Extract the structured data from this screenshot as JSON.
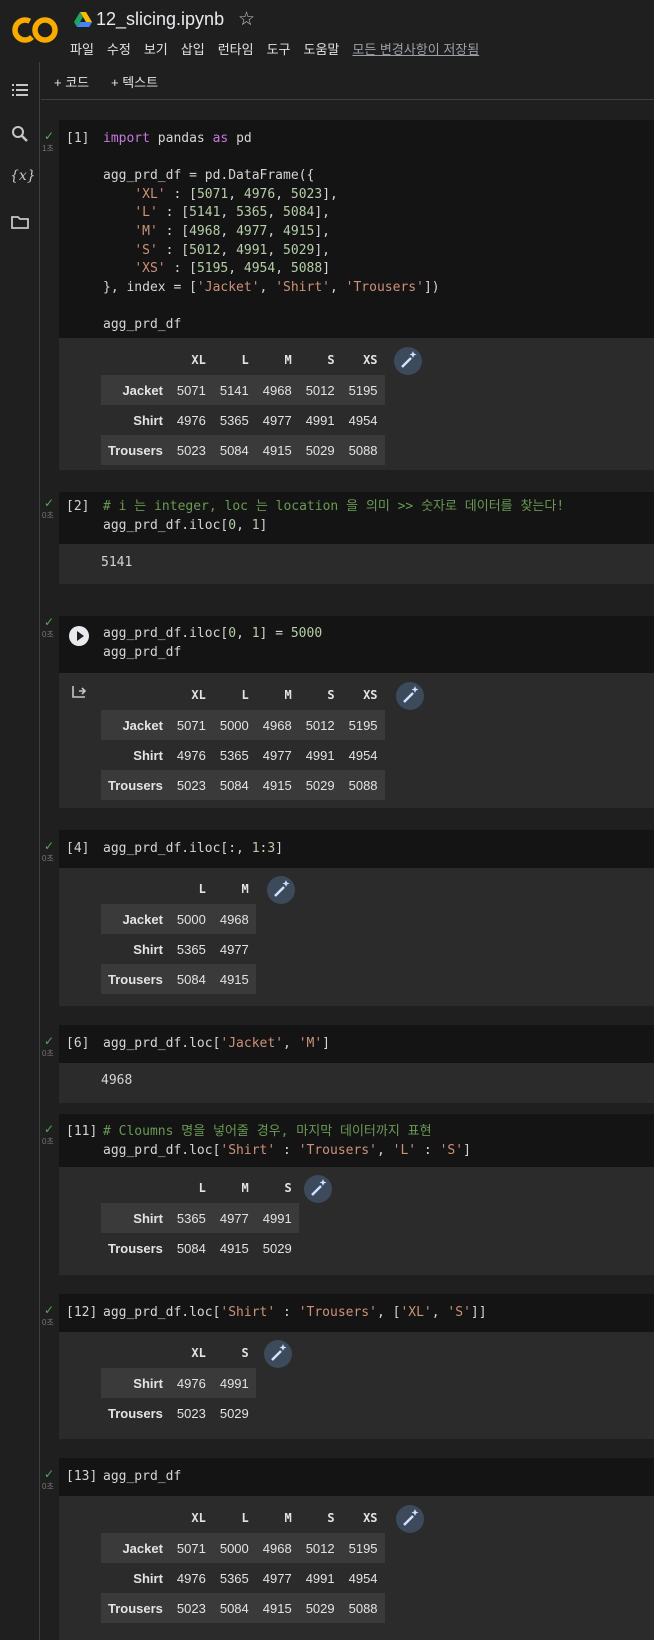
{
  "app": {
    "filename": "12_slicing.ipynb",
    "menu": [
      "파일",
      "수정",
      "보기",
      "삽입",
      "런타임",
      "도구",
      "도움말"
    ],
    "save_status": "모든 변경사항이 저장됨",
    "toolbar": {
      "add_code": "+ 코드",
      "add_text": "+ 텍스트"
    },
    "rail_icons": [
      "table-of-contents-icon",
      "search-icon",
      "variables-icon",
      "files-icon"
    ]
  },
  "cells": [
    {
      "exec": "[1]",
      "time": "1초"
    },
    {
      "exec": "[2]",
      "time": "0초",
      "output": "5141"
    },
    {
      "exec": "",
      "time": "0초"
    },
    {
      "exec": "[4]",
      "time": "0초"
    },
    {
      "exec": "[6]",
      "time": "0초",
      "output": "4968"
    },
    {
      "exec": "[11]",
      "time": "0초"
    },
    {
      "exec": "[12]",
      "time": "0초"
    },
    {
      "exec": "[13]",
      "time": "0초"
    }
  ],
  "code": {
    "c1": [
      "import pandas as pd",
      "",
      "agg_prd_df = pd.DataFrame({",
      "    'XL' : [5071, 4976, 5023],",
      "    'L' : [5141, 5365, 5084],",
      "    'M' : [4968, 4977, 4915],",
      "    'S' : [5012, 4991, 5029],",
      "    'XS' : [5195, 4954, 5088]",
      "}, index = ['Jacket', 'Shirt', 'Trousers'])",
      "",
      "agg_prd_df"
    ],
    "c2": [
      "# i 는 integer, loc 는 location 을 의미 >> 숫자로 데이터를 찾는다!",
      "agg_prd_df.iloc[0, 1]"
    ],
    "c3": [
      "agg_prd_df.iloc[0, 1] = 5000",
      "agg_prd_df"
    ],
    "c4": [
      "agg_prd_df.iloc[:, 1:3]"
    ],
    "c6": [
      "agg_prd_df.loc['Jacket', 'M']"
    ],
    "c11": [
      "# Cloumns 명을 넣어줄 경우, 마지막 데이터까지 표현",
      "agg_prd_df.loc['Shirt' : 'Trousers', 'L' : 'S']"
    ],
    "c12": [
      "agg_prd_df.loc['Shirt' : 'Trousers', ['XL', 'S']]"
    ],
    "c13": [
      "agg_prd_df"
    ]
  },
  "tables": {
    "t1": {
      "columns": [
        "",
        "XL",
        "L",
        "M",
        "S",
        "XS"
      ],
      "rows": [
        [
          "Jacket",
          "5071",
          "5141",
          "4968",
          "5012",
          "5195"
        ],
        [
          "Shirt",
          "4976",
          "5365",
          "4977",
          "4991",
          "4954"
        ],
        [
          "Trousers",
          "5023",
          "5084",
          "4915",
          "5029",
          "5088"
        ]
      ]
    },
    "t3": {
      "columns": [
        "",
        "XL",
        "L",
        "M",
        "S",
        "XS"
      ],
      "rows": [
        [
          "Jacket",
          "5071",
          "5000",
          "4968",
          "5012",
          "5195"
        ],
        [
          "Shirt",
          "4976",
          "5365",
          "4977",
          "4991",
          "4954"
        ],
        [
          "Trousers",
          "5023",
          "5084",
          "4915",
          "5029",
          "5088"
        ]
      ]
    },
    "t4": {
      "columns": [
        "",
        "L",
        "M"
      ],
      "rows": [
        [
          "Jacket",
          "5000",
          "4968"
        ],
        [
          "Shirt",
          "5365",
          "4977"
        ],
        [
          "Trousers",
          "5084",
          "4915"
        ]
      ]
    },
    "t11": {
      "columns": [
        "",
        "L",
        "M",
        "S"
      ],
      "rows": [
        [
          "Shirt",
          "5365",
          "4977",
          "4991"
        ],
        [
          "Trousers",
          "5084",
          "4915",
          "5029"
        ]
      ]
    },
    "t12": {
      "columns": [
        "",
        "XL",
        "S"
      ],
      "rows": [
        [
          "Shirt",
          "4976",
          "4991"
        ],
        [
          "Trousers",
          "5023",
          "5029"
        ]
      ]
    },
    "t13": {
      "columns": [
        "",
        "XL",
        "L",
        "M",
        "S",
        "XS"
      ],
      "rows": [
        [
          "Jacket",
          "5071",
          "5000",
          "4968",
          "5012",
          "5195"
        ],
        [
          "Shirt",
          "4976",
          "5365",
          "4977",
          "4991",
          "4954"
        ],
        [
          "Trousers",
          "5023",
          "5084",
          "4915",
          "5029",
          "5088"
        ]
      ]
    }
  }
}
